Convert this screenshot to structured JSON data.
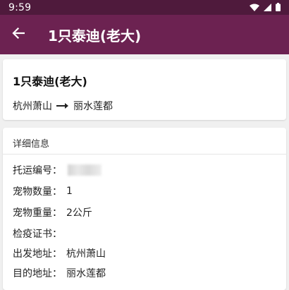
{
  "status_bar": {
    "time": "9:59"
  },
  "app_bar": {
    "title": "1只泰迪(老大)"
  },
  "summary": {
    "title": "1只泰迪(老大)",
    "origin": "杭州萧山",
    "destination": "丽水莲都"
  },
  "detail": {
    "header": "详细信息",
    "rows": [
      {
        "label": "托运编号：",
        "value": ""
      },
      {
        "label": "宠物数量：",
        "value": "1"
      },
      {
        "label": "宠物重量：",
        "value": "2公斤"
      },
      {
        "label": "检疫证书：",
        "value": ""
      },
      {
        "label": "出发地址：",
        "value": "杭州萧山"
      },
      {
        "label": "目的地址：",
        "value": "丽水莲都"
      }
    ]
  },
  "colors": {
    "status_bar": "#4f1a3c",
    "app_bar": "#6c2251",
    "background": "#f0f0f0"
  },
  "icons": [
    "wifi-icon",
    "signal-icon",
    "battery-icon",
    "back-arrow-icon",
    "right-arrow-icon"
  ]
}
